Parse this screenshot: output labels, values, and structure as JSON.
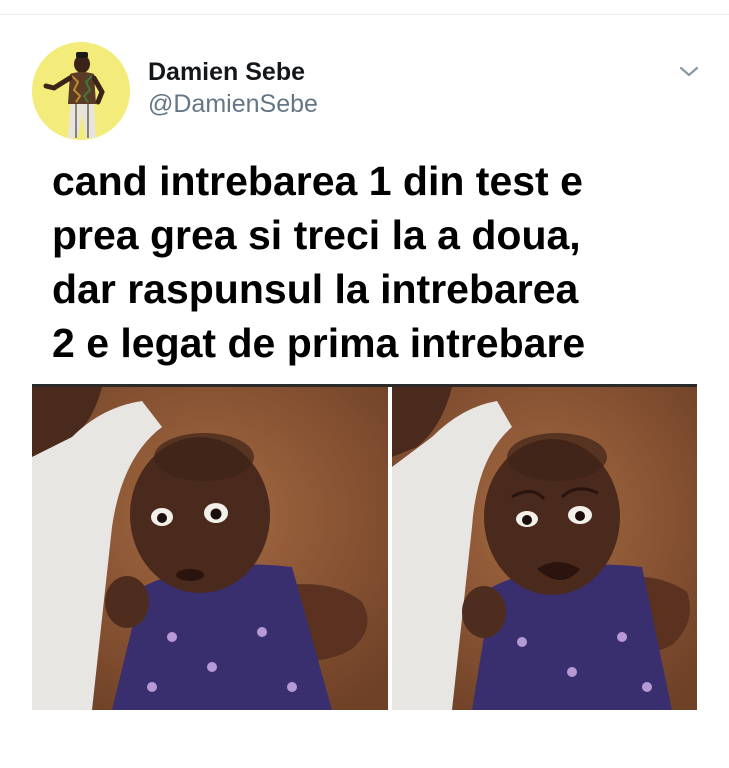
{
  "tweet": {
    "author": {
      "display_name": "Damien Sebe",
      "handle": "@DamienSebe",
      "avatar_icon": "avatar-person-icon"
    },
    "menu_icon": "chevron-down-icon",
    "text": "cand intrebarea 1 din test e\nprea grea si treci la a doua,\ndar raspunsul la intrebarea\n2 e legat de prima intrebare",
    "media": {
      "panels": [
        "baby-worried-photo",
        "baby-crying-photo"
      ]
    }
  },
  "colors": {
    "avatar_bg": "#f4ec7a",
    "name": "#14171a",
    "handle": "#657786",
    "rule": "#e6ecf0",
    "soil": "#8a5534"
  }
}
